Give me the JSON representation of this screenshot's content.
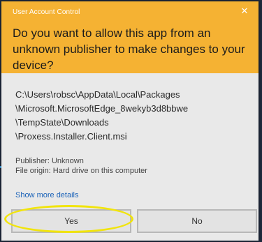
{
  "dialog": {
    "window_title": "User Account Control",
    "close_glyph": "✕",
    "question": "Do you want to allow this app from an unknown publisher to make changes to your device?",
    "path_lines": [
      "C:\\Users\\robsc\\AppData\\Local\\Packages",
      "\\Microsoft.MicrosoftEdge_8wekyb3d8bbwe",
      "\\TempState\\Downloads",
      "\\Proxess.Installer.Client.msi"
    ],
    "publisher": "Publisher: Unknown",
    "file_origin": "File origin: Hard drive on this computer",
    "show_more_details": "Show more details",
    "yes_label": "Yes",
    "no_label": "No"
  },
  "colors": {
    "header": "#f5b233",
    "highlight": "#f1e40c",
    "link": "#1a62b8"
  }
}
